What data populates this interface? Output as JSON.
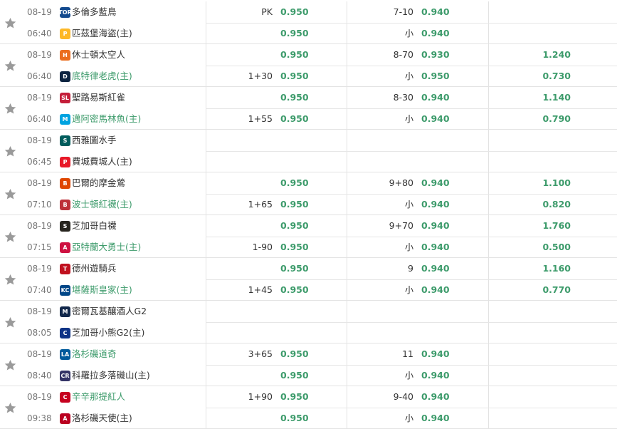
{
  "matches": [
    {
      "date": "08-19",
      "time": "06:40",
      "away": {
        "name": "多倫多藍鳥",
        "logo": "blue-jays-logo",
        "color": "#134a8e",
        "abbr": "TOR",
        "fav": false,
        "hdp": "PK",
        "odds": "0.950",
        "ou": "7-10",
        "ou_odds": "0.940",
        "ml": ""
      },
      "home": {
        "name": "匹茲堡海盜(主)",
        "logo": "pirates-logo",
        "color": "#fdb827",
        "abbr": "P",
        "fav": false,
        "hdp": "",
        "odds": "0.950",
        "ou": "小",
        "ou_odds": "0.940",
        "ml": ""
      }
    },
    {
      "date": "08-19",
      "time": "06:40",
      "away": {
        "name": "休士頓太空人",
        "logo": "astros-logo",
        "color": "#eb6e1f",
        "abbr": "H",
        "fav": false,
        "hdp": "",
        "odds": "0.950",
        "ou": "8-70",
        "ou_odds": "0.930",
        "ml": "1.240"
      },
      "home": {
        "name": "底特律老虎(主)",
        "logo": "tigers-logo",
        "color": "#0c2340",
        "abbr": "D",
        "fav": true,
        "hdp": "1+30",
        "odds": "0.950",
        "ou": "小",
        "ou_odds": "0.950",
        "ml": "0.730"
      }
    },
    {
      "date": "08-19",
      "time": "06:40",
      "away": {
        "name": "聖路易斯紅雀",
        "logo": "cardinals-logo",
        "color": "#c41e3a",
        "abbr": "SL",
        "fav": false,
        "hdp": "",
        "odds": "0.950",
        "ou": "8-30",
        "ou_odds": "0.940",
        "ml": "1.140"
      },
      "home": {
        "name": "邁阿密馬林魚(主)",
        "logo": "marlins-logo",
        "color": "#00a3e0",
        "abbr": "M",
        "fav": true,
        "hdp": "1+55",
        "odds": "0.950",
        "ou": "小",
        "ou_odds": "0.940",
        "ml": "0.790"
      }
    },
    {
      "date": "08-19",
      "time": "06:45",
      "away": {
        "name": "西雅圖水手",
        "logo": "mariners-logo",
        "color": "#005c5c",
        "abbr": "S",
        "fav": false,
        "hdp": "",
        "odds": "",
        "ou": "",
        "ou_odds": "",
        "ml": ""
      },
      "home": {
        "name": "費城費城人(主)",
        "logo": "phillies-logo",
        "color": "#e81828",
        "abbr": "P",
        "fav": false,
        "hdp": "",
        "odds": "",
        "ou": "",
        "ou_odds": "",
        "ml": ""
      }
    },
    {
      "date": "08-19",
      "time": "07:10",
      "away": {
        "name": "巴爾的摩金鶯",
        "logo": "orioles-logo",
        "color": "#df4601",
        "abbr": "B",
        "fav": false,
        "hdp": "",
        "odds": "0.950",
        "ou": "9+80",
        "ou_odds": "0.940",
        "ml": "1.100"
      },
      "home": {
        "name": "波士頓紅襪(主)",
        "logo": "red-sox-logo",
        "color": "#bd3039",
        "abbr": "B",
        "fav": true,
        "hdp": "1+65",
        "odds": "0.950",
        "ou": "小",
        "ou_odds": "0.940",
        "ml": "0.820"
      }
    },
    {
      "date": "08-19",
      "time": "07:15",
      "away": {
        "name": "芝加哥白襪",
        "logo": "white-sox-logo",
        "color": "#27251f",
        "abbr": "S",
        "fav": false,
        "hdp": "",
        "odds": "0.950",
        "ou": "9+70",
        "ou_odds": "0.940",
        "ml": "1.760"
      },
      "home": {
        "name": "亞特蘭大勇士(主)",
        "logo": "braves-logo",
        "color": "#ce1141",
        "abbr": "A",
        "fav": true,
        "hdp": "1-90",
        "odds": "0.950",
        "ou": "小",
        "ou_odds": "0.940",
        "ml": "0.500"
      }
    },
    {
      "date": "08-19",
      "time": "07:40",
      "away": {
        "name": "德州遊騎兵",
        "logo": "rangers-logo",
        "color": "#c0111f",
        "abbr": "T",
        "fav": false,
        "hdp": "",
        "odds": "0.950",
        "ou": "9",
        "ou_odds": "0.940",
        "ml": "1.160"
      },
      "home": {
        "name": "堪薩斯皇家(主)",
        "logo": "royals-logo",
        "color": "#004687",
        "abbr": "KC",
        "fav": true,
        "hdp": "1+45",
        "odds": "0.950",
        "ou": "小",
        "ou_odds": "0.940",
        "ml": "0.770"
      }
    },
    {
      "date": "08-19",
      "time": "08:05",
      "away": {
        "name": "密爾瓦基釀酒人G2",
        "logo": "brewers-logo",
        "color": "#12284b",
        "abbr": "M",
        "fav": false,
        "hdp": "",
        "odds": "",
        "ou": "",
        "ou_odds": "",
        "ml": ""
      },
      "home": {
        "name": "芝加哥小熊G2(主)",
        "logo": "cubs-logo",
        "color": "#0e3386",
        "abbr": "C",
        "fav": false,
        "hdp": "",
        "odds": "",
        "ou": "",
        "ou_odds": "",
        "ml": ""
      }
    },
    {
      "date": "08-19",
      "time": "08:40",
      "away": {
        "name": "洛杉磯道奇",
        "logo": "dodgers-logo",
        "color": "#005a9c",
        "abbr": "LA",
        "fav": true,
        "hdp": "3+65",
        "odds": "0.950",
        "ou": "11",
        "ou_odds": "0.940",
        "ml": ""
      },
      "home": {
        "name": "科羅拉多落磯山(主)",
        "logo": "rockies-logo",
        "color": "#333366",
        "abbr": "CR",
        "fav": false,
        "hdp": "",
        "odds": "0.950",
        "ou": "小",
        "ou_odds": "0.940",
        "ml": ""
      }
    },
    {
      "date": "08-19",
      "time": "09:38",
      "away": {
        "name": "辛辛那提紅人",
        "logo": "reds-logo",
        "color": "#c6011f",
        "abbr": "C",
        "fav": true,
        "hdp": "1+90",
        "odds": "0.950",
        "ou": "9-40",
        "ou_odds": "0.940",
        "ml": ""
      },
      "home": {
        "name": "洛杉磯天使(主)",
        "logo": "angels-logo",
        "color": "#ba0021",
        "abbr": "A",
        "fav": false,
        "hdp": "",
        "odds": "0.950",
        "ou": "小",
        "ou_odds": "0.940",
        "ml": ""
      }
    }
  ]
}
